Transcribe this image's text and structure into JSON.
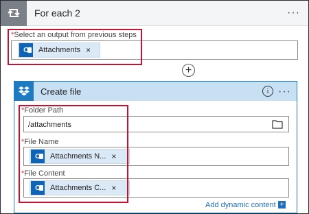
{
  "foreach": {
    "title": "For each 2",
    "icon": "loop-icon",
    "menu_glyph": "···",
    "select_field": {
      "label": "Select an output from previous steps",
      "required_mark": "*",
      "token": {
        "label": "Attachments",
        "icon": "outlook-icon",
        "remove_glyph": "×"
      }
    },
    "add_step_glyph": "+"
  },
  "create_file": {
    "title": "Create file",
    "icon": "dropbox-icon",
    "info_glyph": "i",
    "menu_glyph": "···",
    "fields": {
      "folder_path": {
        "label": "Folder Path",
        "required_mark": "*",
        "value": "/attachments",
        "picker_icon": "folder-icon"
      },
      "file_name": {
        "label": "File Name",
        "required_mark": "*",
        "token": {
          "label": "Attachments N...",
          "icon": "outlook-icon",
          "remove_glyph": "×"
        }
      },
      "file_content": {
        "label": "File Content",
        "required_mark": "*",
        "token": {
          "label": "Attachments C...",
          "icon": "outlook-icon",
          "remove_glyph": "×"
        }
      }
    },
    "dynamic_content_link": "Add dynamic content",
    "dynamic_content_glyph": "+"
  },
  "colors": {
    "accent": "#1f7ac4",
    "highlight_box": "#c8102e",
    "token_bg": "#dbe8f6",
    "outlook_blue": "#0f64b6",
    "required": "#d13438"
  }
}
